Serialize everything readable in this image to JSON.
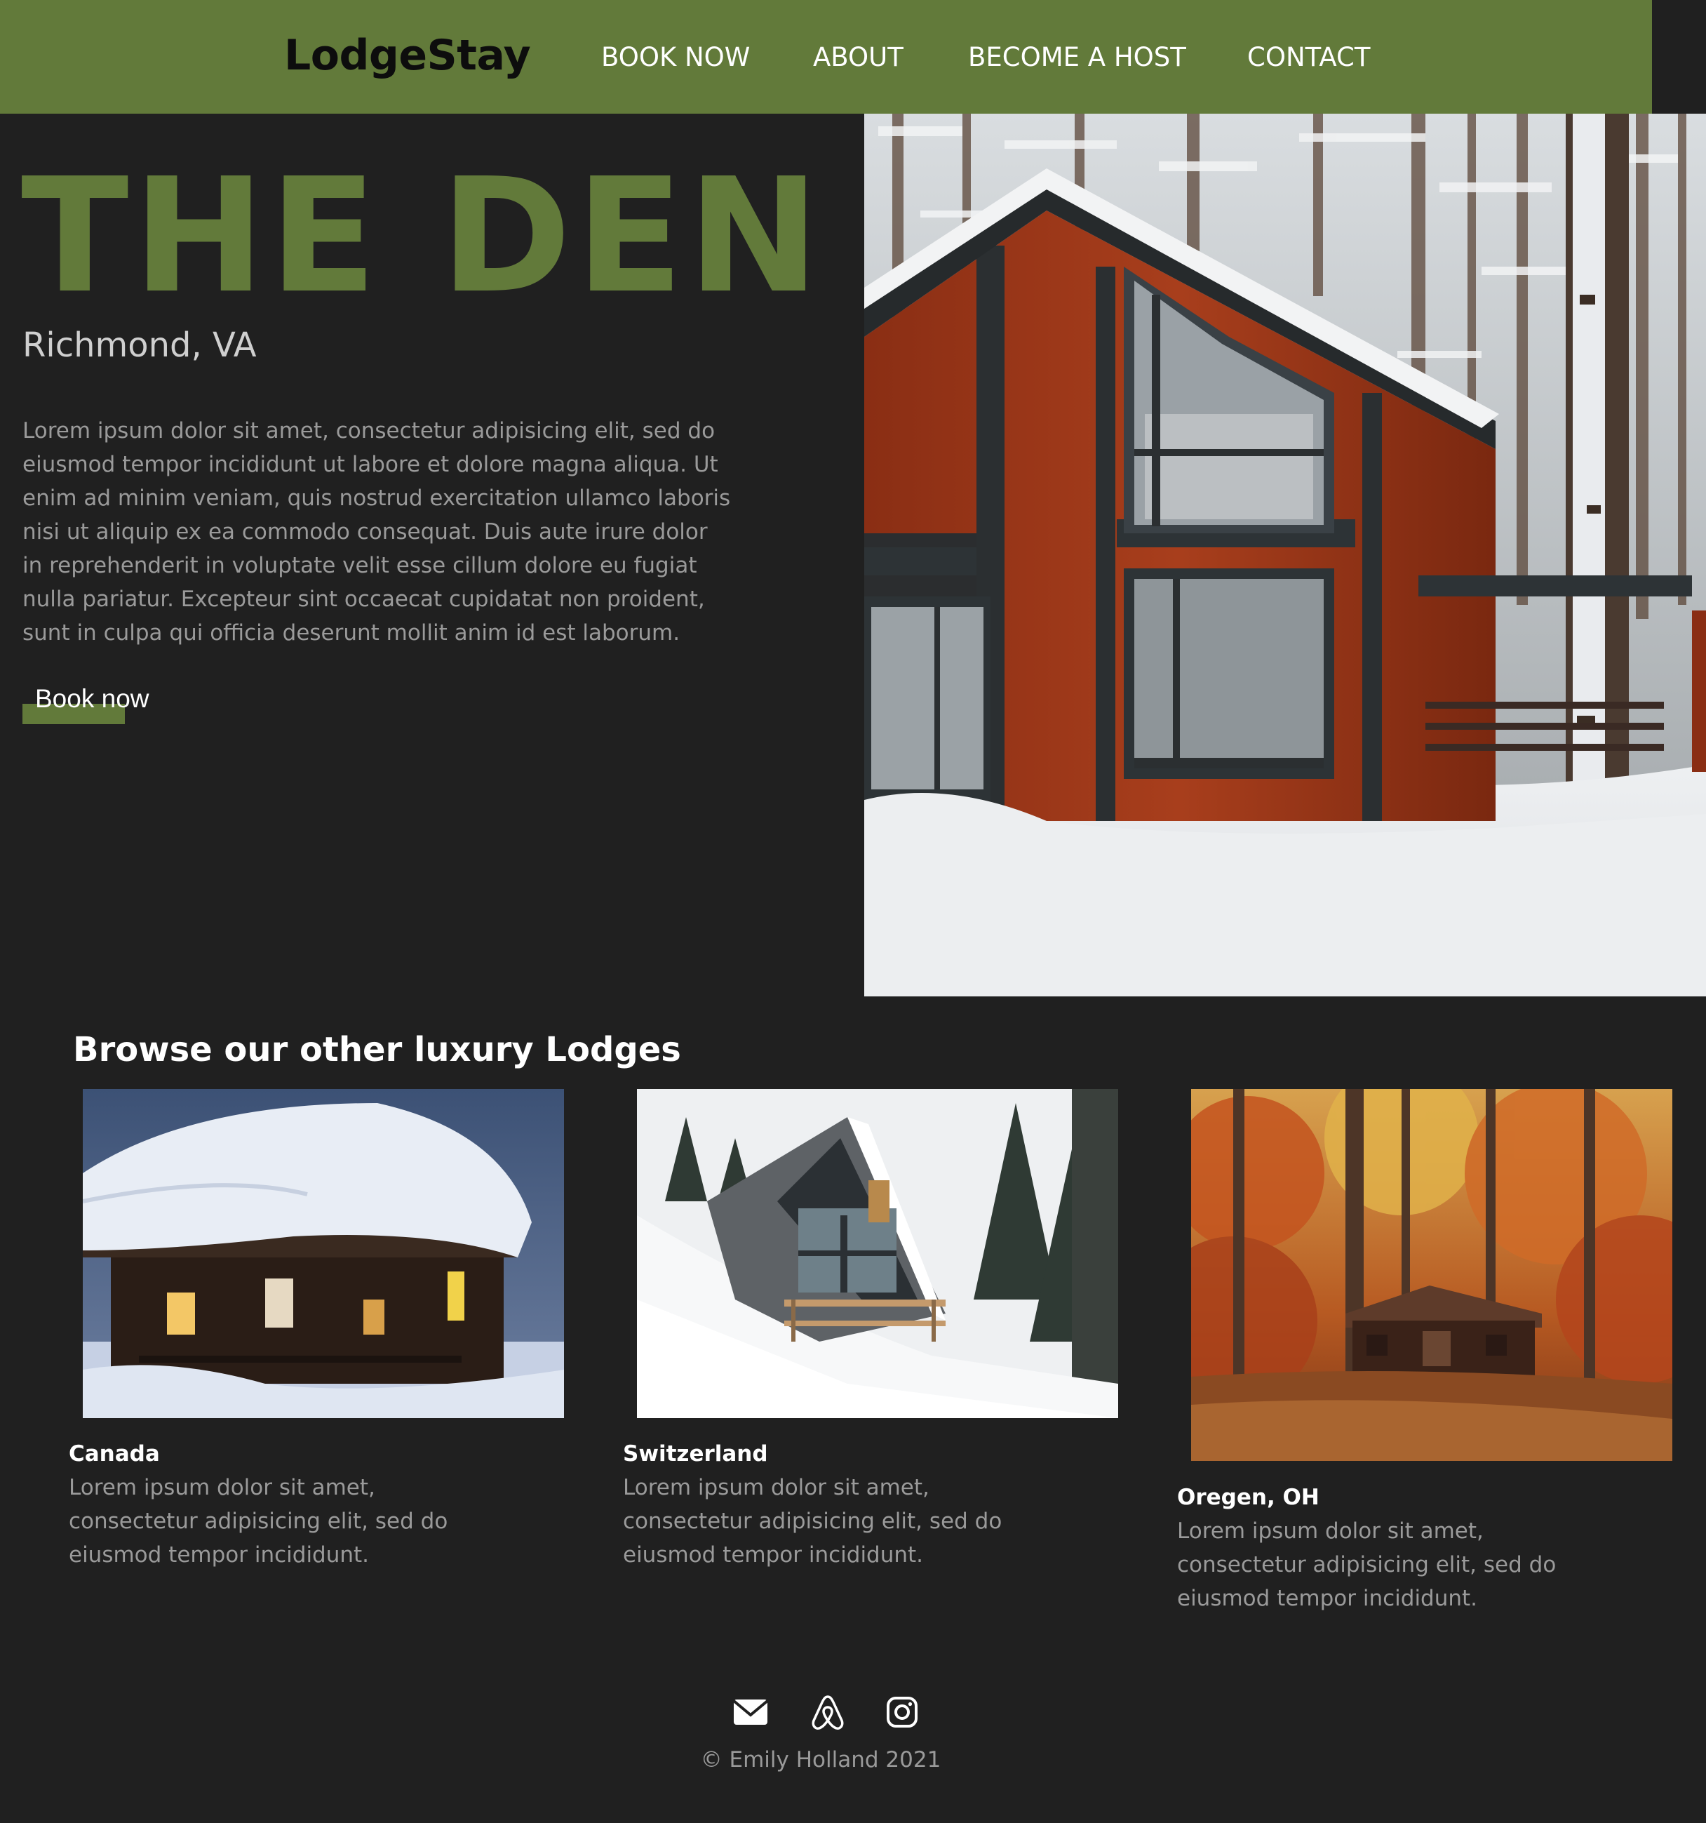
{
  "brand": {
    "name": "LodgeStay"
  },
  "nav": {
    "items": [
      {
        "label": "BOOK NOW"
      },
      {
        "label": "ABOUT"
      },
      {
        "label": "BECOME A HOST"
      },
      {
        "label": "CONTACT"
      }
    ]
  },
  "hero": {
    "title": "THE DEN",
    "location": "Richmond, VA",
    "description": "Lorem ipsum dolor sit amet, consectetur adipisicing elit, sed do eiusmod tempor incididunt ut labore et dolore magna aliqua. Ut enim ad minim veniam, quis nostrud exercitation ullamco laboris nisi ut aliquip ex ea commodo consequat. Duis aute irure dolor in reprehenderit in voluptate velit esse cillum dolore eu fugiat nulla pariatur. Excepteur sint occaecat cupidatat non proident, sunt in culpa qui officia deserunt mollit anim id est laborum.",
    "button_label": "Book now"
  },
  "browse": {
    "title": "Browse our other luxury Lodges",
    "lodges": [
      {
        "name": "Canada",
        "description": "Lorem ipsum dolor sit amet, consectetur adipisicing elit, sed do eiusmod tempor incididunt."
      },
      {
        "name": "Switzerland",
        "description": "Lorem ipsum dolor sit amet, consectetur adipisicing elit, sed do eiusmod tempor incididunt."
      },
      {
        "name": "Oregen, OH",
        "description": "Lorem ipsum dolor sit amet, consectetur adipisicing elit, sed do eiusmod tempor incididunt."
      }
    ]
  },
  "footer": {
    "icons": [
      "envelope-icon",
      "airbnb-icon",
      "instagram-icon"
    ],
    "copyright": "© Emily Holland 2021"
  },
  "colors": {
    "accent": "#627a3a",
    "background": "#202020",
    "muted_text": "#9a9a9a"
  }
}
